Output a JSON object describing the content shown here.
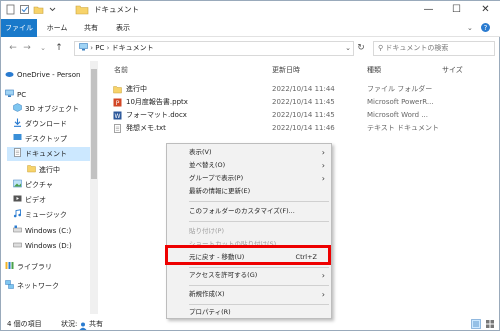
{
  "window": {
    "title": "ドキュメント"
  },
  "ribbon": {
    "tabs": [
      "ファイル",
      "ホーム",
      "共有",
      "表示"
    ]
  },
  "address": {
    "path": [
      "PC",
      "ドキュメント"
    ],
    "search_placeholder": "ドキュメントの検索"
  },
  "sidebar": {
    "items": [
      "OneDrive - Person",
      "PC",
      "3D オブジェクト",
      "ダウンロード",
      "デスクトップ",
      "ドキュメント",
      "進行中",
      "ピクチャ",
      "ビデオ",
      "ミュージック",
      "Windows (C:)",
      "Windows (D:)",
      "ライブラリ",
      "ネットワーク"
    ]
  },
  "filelist": {
    "columns": {
      "name": "名前",
      "date": "更新日時",
      "type": "種類",
      "size": "サイズ"
    },
    "rows": [
      {
        "name": "進行中",
        "date": "2022/10/14 11:44",
        "type": "ファイル フォルダー",
        "size": ""
      },
      {
        "name": "10月度報告書.pptx",
        "date": "2022/10/14 11:45",
        "type": "Microsoft PowerR...",
        "size": ""
      },
      {
        "name": "フォーマット.docx",
        "date": "2022/10/14 11:45",
        "type": "Microsoft Word ...",
        "size": ""
      },
      {
        "name": "発想メモ.txt",
        "date": "2022/10/14 11:46",
        "type": "テキスト ドキュメント",
        "size": ""
      }
    ]
  },
  "status": {
    "count": "4 個の項目",
    "state": "状況: ",
    "shared": "共有"
  },
  "context_menu": {
    "view": "表示(V)",
    "sort": "並べ替え(O)",
    "group": "グループで表示(P)",
    "refresh": "最新の情報に更新(E)",
    "customize": "このフォルダーのカスタマイズ(F)...",
    "paste": "貼り付け(P)",
    "paste_shortcut": "ショートカットの貼り付け(S)",
    "undo_move": "元に戻す - 移動(U)",
    "undo_shortcut": "Ctrl+Z",
    "access": "アクセスを許可する(G)",
    "new": "新規作成(X)",
    "properties": "プロパティ(R)"
  },
  "colors": {
    "accent": "#1979ca",
    "highlight": "#e00000",
    "selected": "#cce8ff"
  }
}
